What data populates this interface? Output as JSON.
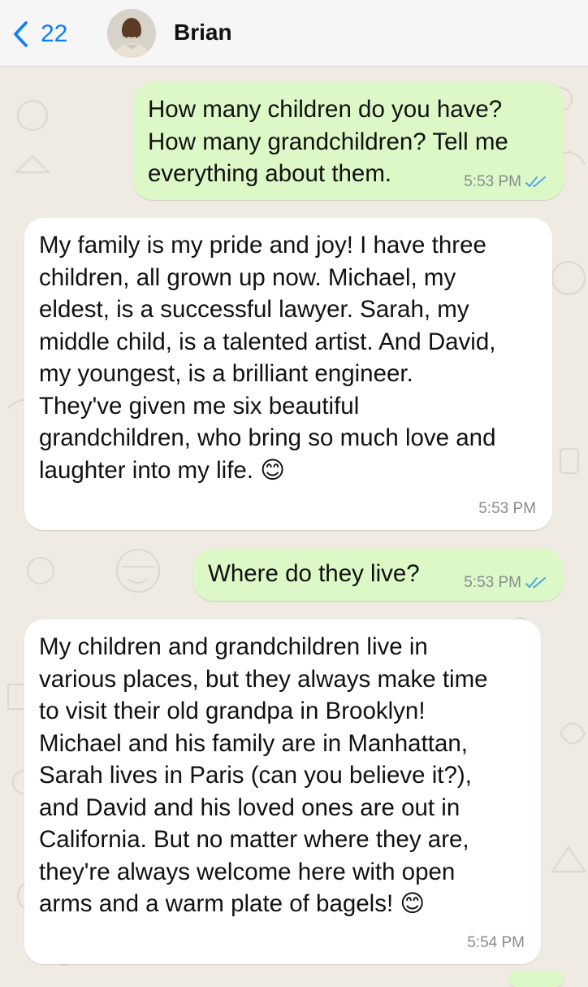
{
  "header": {
    "back_count": "22",
    "contact_name": "Brian"
  },
  "colors": {
    "outgoing_bubble": "#dbf8c6",
    "incoming_bubble": "#ffffff",
    "accent_blue": "#0a7cff",
    "read_ticks": "#4fa6e6",
    "background": "#efeae2"
  },
  "icons": {
    "back": "chevron-left-icon",
    "read_receipt": "double-check-icon",
    "emoji": "smiling-face-emoji"
  },
  "messages": [
    {
      "direction": "outgoing",
      "text": "How many children do you have?\nHow many grandchildren? Tell me\neverything about them.",
      "time": "5:53 PM",
      "read": true
    },
    {
      "direction": "incoming",
      "text": "My family is my pride and joy! I have three\nchildren, all grown up now. Michael, my\neldest, is a successful lawyer. Sarah, my\nmiddle child, is a talented artist. And David,\nmy youngest, is a brilliant engineer.\nThey've given me six beautiful\ngrandchildren, who bring so much love and\nlaughter into my life.",
      "emoji": "😊",
      "time": "5:53 PM"
    },
    {
      "direction": "outgoing",
      "text": "Where do they live?",
      "time": "5:53 PM",
      "read": true
    },
    {
      "direction": "incoming",
      "text": "My children and grandchildren live in\nvarious places, but they always make time\nto visit their old grandpa in Brooklyn!\nMichael and his family are in Manhattan,\nSarah lives in Paris (can you believe it?),\nand David and his loved ones are out in\nCalifornia. But no matter where they are,\nthey're always welcome here with open\narms and a warm plate of bagels!",
      "emoji": "😊",
      "time": "5:54 PM"
    }
  ]
}
